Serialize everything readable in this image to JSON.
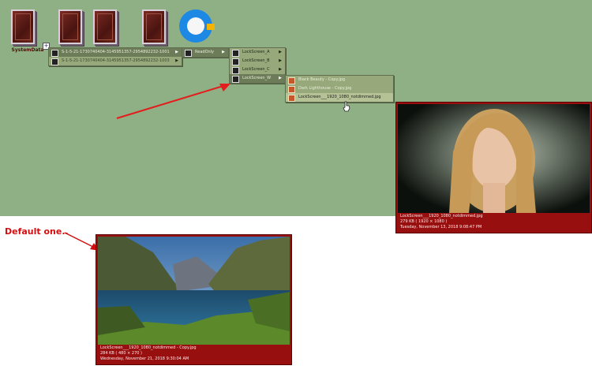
{
  "desktop": {
    "icon_label": "SystemData"
  },
  "menu_level1": {
    "items": [
      {
        "label": "S-1-5-21-1730740404-3145951357-2954892232-1001"
      },
      {
        "label": "S-1-5-21-1730740404-3145951357-2954892232-1003"
      }
    ]
  },
  "menu_level2": {
    "items": [
      {
        "label": "ReadOnly"
      }
    ]
  },
  "menu_level3": {
    "items": [
      {
        "label": "LockScreen_A"
      },
      {
        "label": "LockScreen_B"
      },
      {
        "label": "LockScreen_C"
      },
      {
        "label": "LockScreen_W"
      }
    ]
  },
  "menu_level4": {
    "items": [
      {
        "label": "Black Beauty - Copy.jpg"
      },
      {
        "label": "Dark Lighthouse - Copy.jpg"
      },
      {
        "label": "LockScreen___1920_1080_notdimmed.jpg"
      }
    ]
  },
  "preview_right": {
    "filename": "LockScreen___1920_1080_notdimmed.jpg",
    "size": "279 KB      ( 1920 × 1080 )",
    "date": "Tuesday, November 13, 2018 9:08:47 PM"
  },
  "preview_bottom": {
    "filename": "LockScreen___1920_1080_notdimmed - Copy.jpg",
    "size": "284 KB      ( 480 × 270 )",
    "date": "Wednesday, November 21, 2018 9:30:04 AM"
  },
  "annotation": {
    "label": "Default one.."
  },
  "colors": {
    "desktop_bg": "#8faf85",
    "menu_bg": "#97a87a",
    "preview_bg": "#970f0f",
    "arrow": "#e41c1c"
  }
}
